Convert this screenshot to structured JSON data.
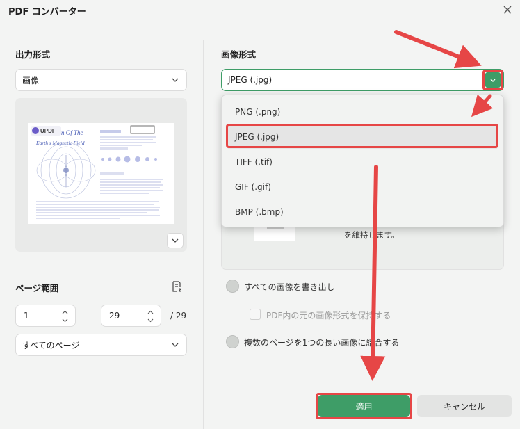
{
  "window": {
    "title": "PDF コンバーター"
  },
  "left": {
    "output_format_label": "出力形式",
    "output_format_value": "画像",
    "preview_logo_text": "UPDF",
    "preview_title": "n Of The",
    "preview_subtitle": "Earth's Magnetic Field",
    "page_range_label": "ページ範囲",
    "range_from": "1",
    "range_sep": "-",
    "range_to": "29",
    "range_total": "/ 29",
    "page_subset": "すべてのページ"
  },
  "right": {
    "image_format_label": "画像形式",
    "image_format_value": "JPEG (.jpg)",
    "options": [
      {
        "label": "PNG (.png)"
      },
      {
        "label": "JPEG (.jpg)"
      },
      {
        "label": "TIFF (.tif)"
      },
      {
        "label": "GIF (.gif)"
      },
      {
        "label": "BMP (.bmp)"
      }
    ],
    "behind_text": "を維持します。",
    "radio_extract_all": "すべての画像を書き出し",
    "checkbox_keep_format": "PDF内の元の画像形式を保持する",
    "radio_long_image": "複数のページを1つの長い画像に結合する"
  },
  "footer": {
    "apply_label": "適用",
    "cancel_label": "キャンセル"
  },
  "colors": {
    "accent_green": "#3e9d67",
    "annotation_red": "#e64646",
    "background": "#f3f4f3"
  },
  "icons": [
    "close-icon",
    "chevron-down-icon",
    "page-list-icon",
    "spinner-arrows-icon",
    "expand-icon",
    "annotation-arrow"
  ]
}
